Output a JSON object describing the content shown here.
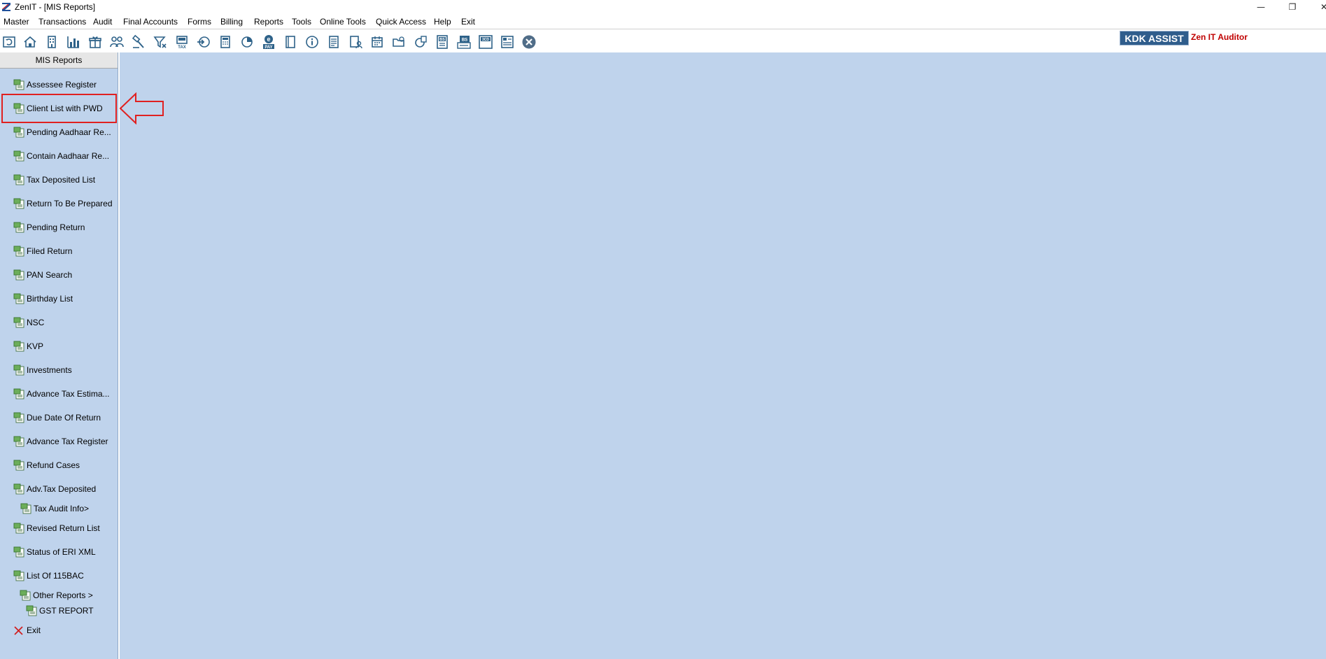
{
  "window": {
    "title": "ZenIT - [MIS Reports]",
    "minimize_glyph": "—",
    "maximize_glyph": "❐",
    "close_glyph": "✕"
  },
  "menu": [
    {
      "label": "Master"
    },
    {
      "label": "Transactions"
    },
    {
      "label": "Audit"
    },
    {
      "label": "Final Accounts"
    },
    {
      "label": "Forms"
    },
    {
      "label": "Billing"
    },
    {
      "label": "Reports"
    },
    {
      "label": "Tools"
    },
    {
      "label": "Online Tools"
    },
    {
      "label": "Quick Access"
    },
    {
      "label": "Help"
    },
    {
      "label": "Exit"
    }
  ],
  "toolbar": {
    "icons": [
      "refresh-icon",
      "home-icon",
      "building-icon",
      "bar-chart-icon",
      "gift-icon",
      "users-icon",
      "hammer-icon",
      "filter-icon",
      "tax-icon",
      "arrow-circle-icon",
      "calculator-icon",
      "pie-chart-icon",
      "e-pay-icon",
      "book-icon",
      "info-icon",
      "ledger-icon",
      "user-document-icon",
      "calendar-icon",
      "folder-icon",
      "circle-doc-icon",
      "bs-icon",
      "bs-add-icon",
      "3cd-icon",
      "report-icon",
      "close-circle-icon"
    ],
    "tax_text": "TAX",
    "pay_text": "PAY",
    "bs_text": "BS",
    "cd_text": "3CD",
    "kdk_assist": "KDK ASSIST",
    "zen_it_auditor": "Zen IT Auditor"
  },
  "sidebar": {
    "header": "MIS Reports",
    "items": [
      {
        "label": "Assessee Register"
      },
      {
        "label": "Client List with PWD"
      },
      {
        "label": "Pending Aadhaar Re..."
      },
      {
        "label": "Contain Aadhaar Re..."
      },
      {
        "label": "Tax Deposited List"
      },
      {
        "label": "Return To Be Prepared"
      },
      {
        "label": "Pending Return"
      },
      {
        "label": "Filed Return"
      },
      {
        "label": "PAN Search"
      },
      {
        "label": "Birthday List"
      },
      {
        "label": "NSC"
      },
      {
        "label": "KVP"
      },
      {
        "label": "Investments"
      },
      {
        "label": "Advance Tax Estima..."
      },
      {
        "label": "Due Date Of Return"
      },
      {
        "label": "Advance Tax Register"
      },
      {
        "label": "Refund Cases"
      },
      {
        "label": "Adv.Tax Deposited"
      },
      {
        "label": "Tax Audit Info>"
      },
      {
        "label": "Revised Return List"
      },
      {
        "label": "Status of ERI XML"
      },
      {
        "label": "List Of 115BAC"
      },
      {
        "label": "Other Reports >"
      },
      {
        "label": "GST REPORT"
      },
      {
        "label": "Exit"
      }
    ]
  },
  "colors": {
    "panel_bg": "#bfd3ec",
    "highlight": "#e02020",
    "kdk_bg": "#2f5d8c",
    "auditor_text": "#c00000"
  }
}
